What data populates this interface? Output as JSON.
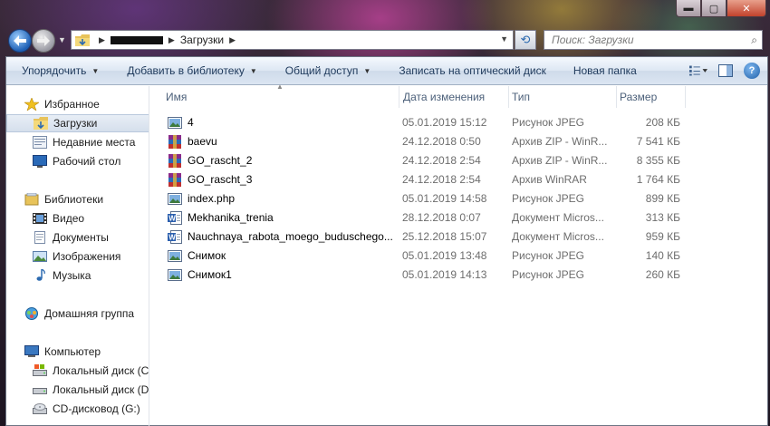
{
  "window": {
    "buttons": {
      "minimize": "▬",
      "maximize": "▢",
      "close": "✕"
    }
  },
  "address": {
    "crumb": "Загрузки",
    "search_placeholder": "Поиск: Загрузки"
  },
  "toolbar": {
    "organize": "Упорядочить",
    "add_library": "Добавить в библиотеку",
    "share": "Общий доступ",
    "burn": "Записать на оптический диск",
    "new_folder": "Новая папка"
  },
  "nav": {
    "favorites": "Избранное",
    "downloads": "Загрузки",
    "recent": "Недавние места",
    "desktop": "Рабочий стол",
    "libraries": "Библиотеки",
    "video": "Видео",
    "documents": "Документы",
    "pictures": "Изображения",
    "music": "Музыка",
    "homegroup": "Домашняя группа",
    "computer": "Компьютер",
    "disk_c": "Локальный диск (C",
    "disk_d": "Локальный диск (D",
    "cd": "CD-дисковод (G:)"
  },
  "columns": {
    "name": "Имя",
    "date": "Дата изменения",
    "type": "Тип",
    "size": "Размер"
  },
  "files": [
    {
      "name": "4",
      "date": "05.01.2019 15:12",
      "type": "Рисунок JPEG",
      "size": "208 КБ",
      "icon": "image-file-icon"
    },
    {
      "name": "baevu",
      "date": "24.12.2018 0:50",
      "type": "Архив ZIP - WinR...",
      "size": "7 541 КБ",
      "icon": "winrar-file-icon"
    },
    {
      "name": "GO_rascht_2",
      "date": "24.12.2018 2:54",
      "type": "Архив ZIP - WinR...",
      "size": "8 355 КБ",
      "icon": "winrar-file-icon"
    },
    {
      "name": "GO_rascht_3",
      "date": "24.12.2018 2:54",
      "type": "Архив WinRAR",
      "size": "1 764 КБ",
      "icon": "winrar-file-icon"
    },
    {
      "name": "index.php",
      "date": "05.01.2019 14:58",
      "type": "Рисунок JPEG",
      "size": "899 КБ",
      "icon": "image-file-icon"
    },
    {
      "name": "Mekhanika_trenia",
      "date": "28.12.2018 0:07",
      "type": "Документ Micros...",
      "size": "313 КБ",
      "icon": "word-file-icon"
    },
    {
      "name": "Nauchnaya_rabota_moego_buduschego...",
      "date": "25.12.2018 15:07",
      "type": "Документ Micros...",
      "size": "959 КБ",
      "icon": "word-file-icon"
    },
    {
      "name": "Снимок",
      "date": "05.01.2019 13:48",
      "type": "Рисунок JPEG",
      "size": "140 КБ",
      "icon": "image-file-icon"
    },
    {
      "name": "Снимок1",
      "date": "05.01.2019 14:13",
      "type": "Рисунок JPEG",
      "size": "260 КБ",
      "icon": "image-file-icon"
    }
  ]
}
